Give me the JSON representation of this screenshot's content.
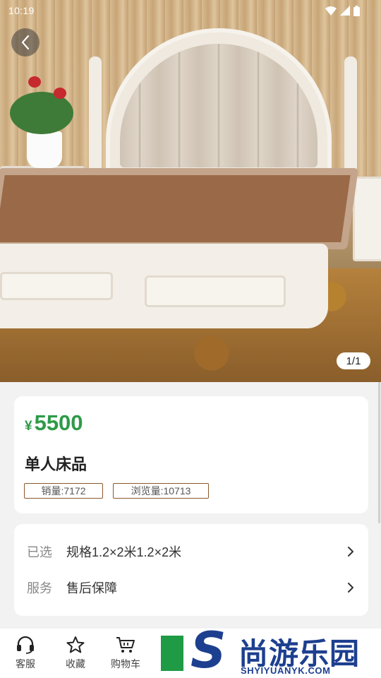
{
  "status_bar": {
    "time": "10:19"
  },
  "gallery": {
    "counter": "1/1"
  },
  "product": {
    "currency_symbol": "¥",
    "price": "5500",
    "name": "单人床品",
    "sales": "销量:7172",
    "views": "浏览量:10713"
  },
  "options": [
    {
      "label": "已选",
      "value": "规格1.2×2米1.2×2米"
    },
    {
      "label": "服务",
      "value": "售后保障"
    }
  ],
  "bottom_nav": [
    {
      "label": "客服",
      "icon": "headset-icon"
    },
    {
      "label": "收藏",
      "icon": "star-icon"
    },
    {
      "label": "购物车",
      "icon": "cart-icon"
    }
  ],
  "watermark": {
    "brand_cn": "尚游乐园",
    "brand_en": "SHYIYUANYK.COM"
  },
  "colors": {
    "price_green": "#2e9a48",
    "tag_border": "#8a5a2b",
    "brand_blue": "#1d3f8f"
  }
}
